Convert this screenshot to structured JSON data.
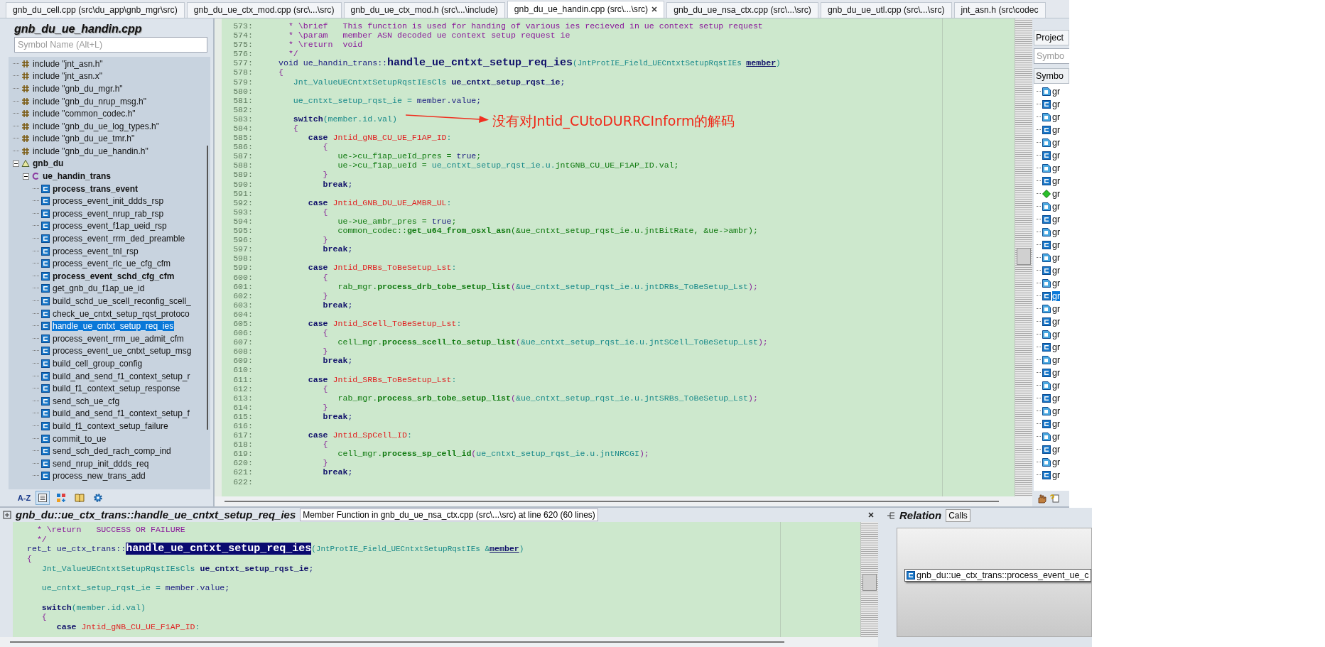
{
  "tabs": [
    {
      "label": "gnb_du_cell.cpp (src\\du_app\\gnb_mgr\\src)",
      "selected": false
    },
    {
      "label": "gnb_du_ue_ctx_mod.cpp (src\\...\\src)",
      "selected": false
    },
    {
      "label": "gnb_du_ue_ctx_mod.h (src\\...\\include)",
      "selected": false
    },
    {
      "label": "gnb_du_ue_handin.cpp (src\\...\\src)",
      "selected": true
    },
    {
      "label": "gnb_du_ue_nsa_ctx.cpp (src\\...\\src)",
      "selected": false
    },
    {
      "label": "gnb_du_ue_utl.cpp (src\\...\\src)",
      "selected": false
    },
    {
      "label": "jnt_asn.h (src\\codec",
      "selected": false
    }
  ],
  "outline": {
    "title": "gnb_du_ue_handin.cpp",
    "search": {
      "placeholder": "Symbol Name (Alt+L)"
    },
    "tree": [
      {
        "kind": "include",
        "label": "include \"jnt_asn.h\"",
        "selected": false
      },
      {
        "kind": "include",
        "label": "include \"jnt_asn.x\"",
        "selected": false
      },
      {
        "kind": "include",
        "label": "include \"gnb_du_mgr.h\"",
        "selected": false
      },
      {
        "kind": "include",
        "label": "include \"gnb_du_nrup_msg.h\"",
        "selected": false
      },
      {
        "kind": "include",
        "label": "include \"common_codec.h\"",
        "selected": false
      },
      {
        "kind": "include",
        "label": "include \"gnb_du_ue_log_types.h\"",
        "selected": false
      },
      {
        "kind": "include",
        "label": "include \"gnb_du_ue_tmr.h\"",
        "selected": false
      },
      {
        "kind": "include",
        "label": "include \"gnb_du_ue_handin.h\"",
        "selected": false
      },
      {
        "kind": "namespace",
        "label": "gnb_du",
        "selected": false,
        "expanded": true,
        "children": [
          {
            "kind": "class",
            "label": "ue_handin_trans",
            "selected": false,
            "expanded": true,
            "children": [
              {
                "kind": "method",
                "label": "process_trans_event",
                "bold": true,
                "selected": false
              },
              {
                "kind": "method",
                "label": "process_event_init_ddds_rsp",
                "bold": false,
                "selected": false
              },
              {
                "kind": "method",
                "label": "process_event_nrup_rab_rsp",
                "bold": false,
                "selected": false
              },
              {
                "kind": "method",
                "label": "process_event_f1ap_ueid_rsp",
                "bold": false,
                "selected": false
              },
              {
                "kind": "method",
                "label": "process_event_rrm_ded_preamble",
                "bold": false,
                "selected": false
              },
              {
                "kind": "method",
                "label": "process_event_tnl_rsp",
                "bold": false,
                "selected": false
              },
              {
                "kind": "method",
                "label": "process_event_rlc_ue_cfg_cfm",
                "bold": false,
                "selected": false
              },
              {
                "kind": "method",
                "label": "process_event_schd_cfg_cfm",
                "bold": true,
                "selected": false
              },
              {
                "kind": "method",
                "label": "get_gnb_du_f1ap_ue_id",
                "bold": false,
                "selected": false
              },
              {
                "kind": "method",
                "label": "build_schd_ue_scell_reconfig_scell_",
                "bold": false,
                "selected": false
              },
              {
                "kind": "method",
                "label": "check_ue_cntxt_setup_rqst_protoco",
                "bold": false,
                "selected": false
              },
              {
                "kind": "method",
                "label": "handle_ue_cntxt_setup_req_ies",
                "bold": false,
                "selected": true
              },
              {
                "kind": "method",
                "label": "process_event_rrm_ue_admit_cfm",
                "bold": false,
                "selected": false
              },
              {
                "kind": "method",
                "label": "process_event_ue_cntxt_setup_msg",
                "bold": false,
                "selected": false
              },
              {
                "kind": "method",
                "label": "build_cell_group_config",
                "bold": false,
                "selected": false
              },
              {
                "kind": "method",
                "label": "build_and_send_f1_context_setup_r",
                "bold": false,
                "selected": false
              },
              {
                "kind": "method",
                "label": "build_f1_context_setup_response",
                "bold": false,
                "selected": false
              },
              {
                "kind": "method",
                "label": "send_sch_ue_cfg",
                "bold": false,
                "selected": false
              },
              {
                "kind": "method",
                "label": "build_and_send_f1_context_setup_f",
                "bold": false,
                "selected": false
              },
              {
                "kind": "method",
                "label": "build_f1_context_setup_failure",
                "bold": false,
                "selected": false
              },
              {
                "kind": "method",
                "label": "commit_to_ue",
                "bold": false,
                "selected": false
              },
              {
                "kind": "method",
                "label": "send_sch_ded_rach_comp_ind",
                "bold": false,
                "selected": false
              },
              {
                "kind": "method",
                "label": "send_nrup_init_ddds_req",
                "bold": false,
                "selected": false
              },
              {
                "kind": "method",
                "label": "process_new_trans_add",
                "bold": false,
                "selected": false
              }
            ]
          }
        ]
      }
    ],
    "toolbar": [
      {
        "kind": "sort",
        "label": "A-Z",
        "pressed": false
      },
      {
        "kind": "list",
        "pressed": true
      },
      {
        "kind": "types",
        "pressed": false
      },
      {
        "kind": "book",
        "pressed": false
      },
      {
        "kind": "settings",
        "pressed": false
      }
    ]
  },
  "editor": {
    "lines": [
      {
        "number": "573:",
        "tokens": [
          {
            "kind": "comment",
            "text": "  * \\brief   This function is used for handing of various ies recieved in ue context setup request"
          }
        ]
      },
      {
        "number": "574:",
        "tokens": [
          {
            "kind": "comment",
            "text": "  * \\param   member ASN decoded ue context setup request ie"
          }
        ]
      },
      {
        "number": "575:",
        "tokens": [
          {
            "kind": "comment",
            "text": "  * \\return  void"
          }
        ]
      },
      {
        "number": "576:",
        "tokens": [
          {
            "kind": "comment",
            "text": "  */"
          }
        ]
      },
      {
        "number": "577:",
        "tokens": [
          {
            "kind": "name",
            "text": "void ue_handin_trans::"
          },
          {
            "kind": "def",
            "text": "handle_ue_cntxt_setup_req_ies"
          },
          {
            "kind": "param",
            "text": "(JntProtIE_Field_UECntxtSetupRqstIEs "
          },
          {
            "kind": "ref",
            "text": "member"
          },
          {
            "kind": "param",
            "text": ")"
          }
        ]
      },
      {
        "number": "578:",
        "tokens": [
          {
            "kind": "punct",
            "text": "{"
          }
        ]
      },
      {
        "number": "579:",
        "tokens": [
          {
            "kind": "var",
            "text": "   Jnt_ValueUECntxtSetupRqstIEsCls "
          },
          {
            "kind": "decl",
            "text": "ue_cntxt_setup_rqst_ie"
          },
          {
            "kind": "name",
            "text": ";"
          }
        ]
      },
      {
        "number": "580:"
      },
      {
        "number": "581:",
        "tokens": [
          {
            "kind": "var",
            "text": "   ue_cntxt_setup_rqst_ie = "
          },
          {
            "kind": "name",
            "text": "member.value;"
          }
        ]
      },
      {
        "number": "582:"
      },
      {
        "number": "583:",
        "tokens": [
          {
            "kind": "kw",
            "text": "   switch"
          },
          {
            "kind": "var",
            "text": "(member.id.val)"
          }
        ],
        "note": "没有对Jntid_CUtoDURRCInform的解码"
      },
      {
        "number": "584:",
        "tokens": [
          {
            "kind": "punct",
            "text": "   {"
          }
        ]
      },
      {
        "number": "585:",
        "tokens": [
          {
            "kind": "kw",
            "text": "      case "
          },
          {
            "kind": "enum",
            "text": "Jntid_gNB_CU_UE_F1AP_ID"
          },
          {
            "kind": "var",
            "text": ":"
          }
        ]
      },
      {
        "number": "586:",
        "tokens": [
          {
            "kind": "punct",
            "text": "         {"
          }
        ]
      },
      {
        "number": "587:",
        "tokens": [
          {
            "kind": "code",
            "text": "            ue->cu_f1ap_ueId_pres = "
          },
          {
            "kind": "name",
            "text": "true"
          },
          {
            "kind": "code",
            "text": ";"
          }
        ]
      },
      {
        "number": "588:",
        "tokens": [
          {
            "kind": "code",
            "text": "            ue->cu_f1ap_ueId = "
          },
          {
            "kind": "var",
            "text": "ue_cntxt_setup_rqst_ie.u."
          },
          {
            "kind": "code",
            "text": "jntGNB_CU_UE_F1AP_ID.val;"
          }
        ]
      },
      {
        "number": "589:",
        "tokens": [
          {
            "kind": "punct",
            "text": "         }"
          }
        ]
      },
      {
        "number": "590:",
        "tokens": [
          {
            "kind": "kw",
            "text": "         break"
          },
          {
            "kind": "name",
            "text": ";"
          }
        ]
      },
      {
        "number": "591:"
      },
      {
        "number": "592:",
        "tokens": [
          {
            "kind": "kw",
            "text": "      case "
          },
          {
            "kind": "enum",
            "text": "Jntid_GNB_DU_UE_AMBR_UL"
          },
          {
            "kind": "var",
            "text": ":"
          }
        ]
      },
      {
        "number": "593:",
        "tokens": [
          {
            "kind": "punct",
            "text": "         {"
          }
        ]
      },
      {
        "number": "594:",
        "tokens": [
          {
            "kind": "code",
            "text": "            ue->ue_ambr_pres = "
          },
          {
            "kind": "name",
            "text": "true"
          },
          {
            "kind": "code",
            "text": ";"
          }
        ]
      },
      {
        "number": "595:",
        "tokens": [
          {
            "kind": "code",
            "text": "            common_codec::"
          },
          {
            "kind": "call",
            "text": "get_u64_from_osxl_asn"
          },
          {
            "kind": "code",
            "text": "(&ue_cntxt_setup_rqst_ie.u.jntBitRate, &ue->ambr);"
          }
        ]
      },
      {
        "number": "596:",
        "tokens": [
          {
            "kind": "punct",
            "text": "         }"
          }
        ]
      },
      {
        "number": "597:",
        "tokens": [
          {
            "kind": "kw",
            "text": "         break"
          },
          {
            "kind": "name",
            "text": ";"
          }
        ]
      },
      {
        "number": "598:"
      },
      {
        "number": "599:",
        "tokens": [
          {
            "kind": "kw",
            "text": "      case "
          },
          {
            "kind": "enum",
            "text": "Jntid_DRBs_ToBeSetup_Lst"
          },
          {
            "kind": "var",
            "text": ":"
          }
        ]
      },
      {
        "number": "600:",
        "tokens": [
          {
            "kind": "punct",
            "text": "         {"
          }
        ]
      },
      {
        "number": "601:",
        "tokens": [
          {
            "kind": "code",
            "text": "            rab_mgr."
          },
          {
            "kind": "call",
            "text": "process_drb_tobe_setup_list"
          },
          {
            "kind": "punct",
            "text": "("
          },
          {
            "kind": "var",
            "text": "&ue_cntxt_setup_rqst_ie.u.jntDRBs_ToBeSetup_Lst"
          },
          {
            "kind": "punct",
            "text": ");"
          }
        ]
      },
      {
        "number": "602:",
        "tokens": [
          {
            "kind": "punct",
            "text": "         }"
          }
        ]
      },
      {
        "number": "603:",
        "tokens": [
          {
            "kind": "kw",
            "text": "         break"
          },
          {
            "kind": "name",
            "text": ";"
          }
        ]
      },
      {
        "number": "604:"
      },
      {
        "number": "605:",
        "tokens": [
          {
            "kind": "kw",
            "text": "      case "
          },
          {
            "kind": "enum",
            "text": "Jntid_SCell_ToBeSetup_Lst"
          },
          {
            "kind": "var",
            "text": ":"
          }
        ]
      },
      {
        "number": "606:",
        "tokens": [
          {
            "kind": "punct",
            "text": "         {"
          }
        ]
      },
      {
        "number": "607:",
        "tokens": [
          {
            "kind": "code",
            "text": "            cell_mgr."
          },
          {
            "kind": "call",
            "text": "process_scell_to_setup_list"
          },
          {
            "kind": "punct",
            "text": "("
          },
          {
            "kind": "var",
            "text": "&ue_cntxt_setup_rqst_ie.u.jntSCell_ToBeSetup_Lst"
          },
          {
            "kind": "punct",
            "text": ");"
          }
        ]
      },
      {
        "number": "608:",
        "tokens": [
          {
            "kind": "punct",
            "text": "         }"
          }
        ]
      },
      {
        "number": "609:",
        "tokens": [
          {
            "kind": "kw",
            "text": "         break"
          },
          {
            "kind": "name",
            "text": ";"
          }
        ]
      },
      {
        "number": "610:"
      },
      {
        "number": "611:",
        "tokens": [
          {
            "kind": "kw",
            "text": "      case "
          },
          {
            "kind": "enum",
            "text": "Jntid_SRBs_ToBeSetup_Lst"
          },
          {
            "kind": "var",
            "text": ":"
          }
        ]
      },
      {
        "number": "612:",
        "tokens": [
          {
            "kind": "punct",
            "text": "         {"
          }
        ]
      },
      {
        "number": "613:",
        "tokens": [
          {
            "kind": "code",
            "text": "            rab_mgr."
          },
          {
            "kind": "call",
            "text": "process_srb_tobe_setup_list"
          },
          {
            "kind": "punct",
            "text": "("
          },
          {
            "kind": "var",
            "text": "&ue_cntxt_setup_rqst_ie.u.jntSRBs_ToBeSetup_Lst"
          },
          {
            "kind": "punct",
            "text": ");"
          }
        ]
      },
      {
        "number": "614:",
        "tokens": [
          {
            "kind": "punct",
            "text": "         }"
          }
        ]
      },
      {
        "number": "615:",
        "tokens": [
          {
            "kind": "kw",
            "text": "         break"
          },
          {
            "kind": "name",
            "text": ";"
          }
        ]
      },
      {
        "number": "616:"
      },
      {
        "number": "617:",
        "tokens": [
          {
            "kind": "kw",
            "text": "      case "
          },
          {
            "kind": "enum",
            "text": "Jntid_SpCell_ID"
          },
          {
            "kind": "var",
            "text": ":"
          }
        ]
      },
      {
        "number": "618:",
        "tokens": [
          {
            "kind": "punct",
            "text": "         {"
          }
        ]
      },
      {
        "number": "619:",
        "tokens": [
          {
            "kind": "code",
            "text": "            cell_mgr."
          },
          {
            "kind": "call",
            "text": "process_sp_cell_id"
          },
          {
            "kind": "punct",
            "text": "("
          },
          {
            "kind": "var",
            "text": "ue_cntxt_setup_rqst_ie.u.jntNRCGI"
          },
          {
            "kind": "punct",
            "text": ");"
          }
        ]
      },
      {
        "number": "620:",
        "tokens": [
          {
            "kind": "punct",
            "text": "         }"
          }
        ]
      },
      {
        "number": "621:",
        "tokens": [
          {
            "kind": "kw",
            "text": "         break"
          },
          {
            "kind": "name",
            "text": ";"
          }
        ]
      },
      {
        "number": "622:"
      }
    ]
  },
  "project_panel": {
    "tab": "Project",
    "search": {
      "placeholder": "Symbo"
    },
    "column": "Symbo",
    "rows": [
      {
        "kind": "member",
        "label": "gr",
        "selected": false
      },
      {
        "kind": "function",
        "label": "gr",
        "selected": false
      },
      {
        "kind": "member",
        "label": "gr",
        "selected": false
      },
      {
        "kind": "function",
        "label": "gr",
        "selected": false
      },
      {
        "kind": "member",
        "label": "gr",
        "selected": false
      },
      {
        "kind": "function",
        "label": "gr",
        "selected": false
      },
      {
        "kind": "member",
        "label": "gr",
        "selected": false
      },
      {
        "kind": "function",
        "label": "gr",
        "selected": false
      },
      {
        "kind": "variable",
        "label": "gr",
        "selected": false
      },
      {
        "kind": "member",
        "label": "gr",
        "selected": false
      },
      {
        "kind": "function",
        "label": "gr",
        "selected": false
      },
      {
        "kind": "member",
        "label": "gr",
        "selected": false
      },
      {
        "kind": "function",
        "label": "gr",
        "selected": false
      },
      {
        "kind": "member",
        "label": "gr",
        "selected": false
      },
      {
        "kind": "function",
        "label": "gr",
        "selected": false
      },
      {
        "kind": "member",
        "label": "gr",
        "selected": false
      },
      {
        "kind": "function",
        "label": "gr",
        "selected": true
      },
      {
        "kind": "member",
        "label": "gr",
        "selected": false
      },
      {
        "kind": "function",
        "label": "gr",
        "selected": false
      },
      {
        "kind": "member",
        "label": "gr",
        "selected": false
      },
      {
        "kind": "function",
        "label": "gr",
        "selected": false
      },
      {
        "kind": "member",
        "label": "gr",
        "selected": false
      },
      {
        "kind": "function",
        "label": "gr",
        "selected": false
      },
      {
        "kind": "member",
        "label": "gr",
        "selected": false
      },
      {
        "kind": "function",
        "label": "gr",
        "selected": false
      },
      {
        "kind": "member",
        "label": "gr",
        "selected": false
      },
      {
        "kind": "function",
        "label": "gr",
        "selected": false
      },
      {
        "kind": "member",
        "label": "gr",
        "selected": false
      },
      {
        "kind": "function",
        "label": "gr",
        "selected": false
      },
      {
        "kind": "member",
        "label": "gr",
        "selected": false
      },
      {
        "kind": "function",
        "label": "gr",
        "selected": false
      }
    ]
  },
  "context_panel": {
    "title": "gnb_du::ue_ctx_trans::handle_ue_cntxt_setup_req_ies",
    "info": "Member Function in gnb_du_ue_nsa_ctx.cpp (src\\...\\src) at line 620 (60 lines)",
    "lines": [
      {
        "kind": "code",
        "tokens": [
          {
            "kind": "comment",
            "text": "  * \\return   SUCCESS OR FAILURE"
          }
        ]
      },
      {
        "kind": "code",
        "tokens": [
          {
            "kind": "comment",
            "text": "  */"
          }
        ]
      },
      {
        "kind": "code",
        "tokens": [
          {
            "kind": "name",
            "text": "ret_t ue_ctx_trans::"
          },
          {
            "kind": "sel",
            "text": "handle_ue_cntxt_setup_req_ies"
          },
          {
            "kind": "param",
            "text": "(JntProtIE_Field_UECntxtSetupRqstIEs &"
          },
          {
            "kind": "ref",
            "text": "member"
          },
          {
            "kind": "param",
            "text": ")"
          }
        ]
      },
      {
        "kind": "code",
        "tokens": [
          {
            "kind": "punct",
            "text": "{"
          }
        ]
      },
      {
        "kind": "code",
        "tokens": [
          {
            "kind": "var",
            "text": "   Jnt_ValueUECntxtSetupRqstIEsCls "
          },
          {
            "kind": "decl",
            "text": "ue_cntxt_setup_rqst_ie"
          },
          {
            "kind": "name",
            "text": ";"
          }
        ]
      },
      {
        "kind": "blank"
      },
      {
        "kind": "code",
        "tokens": [
          {
            "kind": "var",
            "text": "   ue_cntxt_setup_rqst_ie = "
          },
          {
            "kind": "name",
            "text": "member.value;"
          }
        ]
      },
      {
        "kind": "blank"
      },
      {
        "kind": "code",
        "tokens": [
          {
            "kind": "kw",
            "text": "   switch"
          },
          {
            "kind": "var",
            "text": "(member.id.val)"
          }
        ]
      },
      {
        "kind": "code",
        "tokens": [
          {
            "kind": "punct",
            "text": "   {"
          }
        ]
      },
      {
        "kind": "code",
        "tokens": [
          {
            "kind": "kw",
            "text": "      case "
          },
          {
            "kind": "enum",
            "text": "Jntid_gNB_CU_UE_F1AP_ID"
          },
          {
            "kind": "var",
            "text": ":"
          }
        ]
      }
    ]
  },
  "relation_panel": {
    "title": "Relation",
    "button": "Calls",
    "nodes": [
      {
        "label": "gnb_du::ue_ctx_trans::process_event_ue_c"
      }
    ]
  }
}
